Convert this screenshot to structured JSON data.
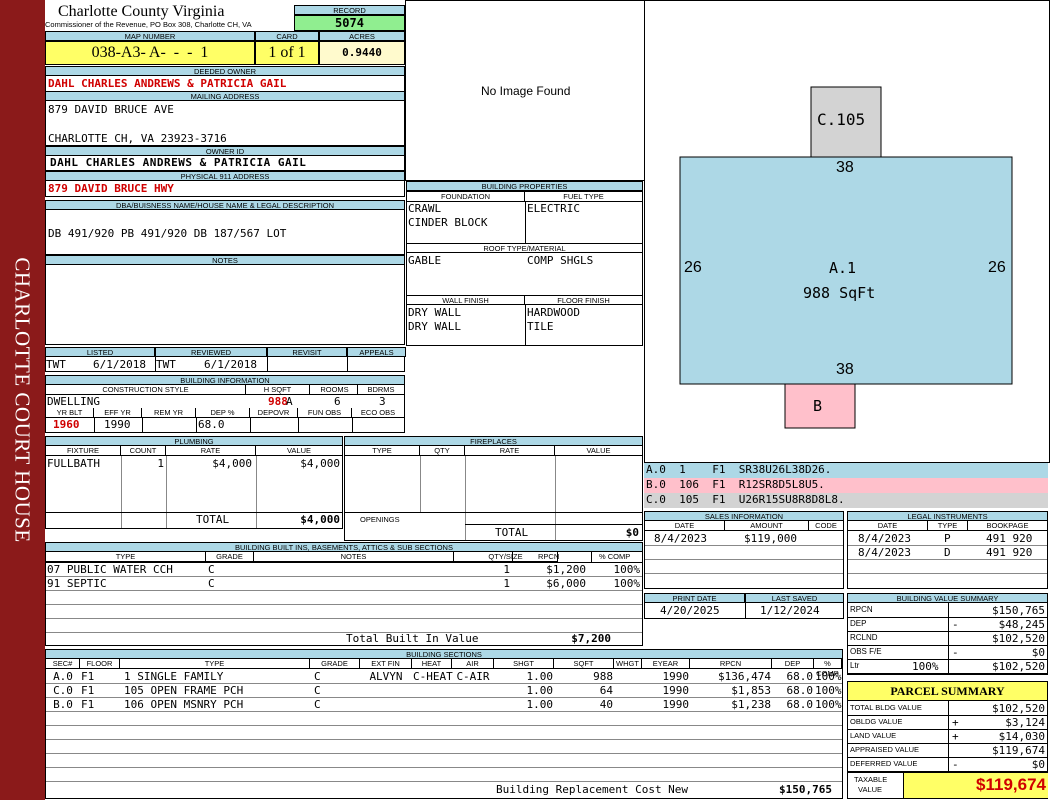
{
  "side_banner": "CHARLOTTE COURT HOUSE",
  "header": {
    "county": "Charlotte County Virginia",
    "office": "Commissioner of the Revenue, PO Box 308, Charlotte CH, VA",
    "record_label": "RECORD",
    "record": "5074",
    "map_label": "MAP NUMBER",
    "map": "038-A3- A-  -  -  1",
    "card_label": "CARD",
    "card": "1 of 1",
    "acres_label": "ACRES",
    "acres": "0.9440"
  },
  "owner": {
    "deeded_label": "DEEDED OWNER",
    "deeded": "DAHL CHARLES ANDREWS & PATRICIA GAIL",
    "mailing_label": "MAILING ADDRESS",
    "mail1": "879 DAVID BRUCE AVE",
    "mail2": "CHARLOTTE CH, VA 23923-3716",
    "ownerid_label": "OWNER ID",
    "ownerid": "DAHL CHARLES ANDREWS & PATRICIA GAIL",
    "phys_label": "PHYSICAL 911 ADDRESS",
    "phys": "879 DAVID BRUCE HWY"
  },
  "legal": {
    "label": "DBA/BUISNESS NAME/HOUSE NAME & LEGAL DESCRIPTION",
    "text": "DB 491/920 PB 491/920 DB 187/567 LOT"
  },
  "notes": {
    "label": "NOTES",
    "text": ""
  },
  "photo": {
    "text": "No Image Found"
  },
  "building_properties": {
    "label": "BUILDING PROPERTIES",
    "foundation_label": "FOUNDATION",
    "foundation1": "CRAWL",
    "foundation2": "CINDER BLOCK",
    "fuel_label": "FUEL TYPE",
    "fuel": "ELECTRIC",
    "roof_label": "ROOF TYPE/MATERIAL",
    "roof_type": "GABLE",
    "roof_mat": "COMP SHGLS",
    "wall_label": "WALL FINISH",
    "wall1": "DRY WALL",
    "wall2": "DRY WALL",
    "floor_label": "FLOOR FINISH",
    "floor1": "HARDWOOD",
    "floor2": "TILE"
  },
  "review": {
    "listed_label": "LISTED",
    "listed_by": "TWT",
    "listed_date": "6/1/2018",
    "reviewed_label": "REVIEWED",
    "reviewed_by": "TWT",
    "reviewed_date": "6/1/2018",
    "revisit_label": "REVISIT",
    "appeals_label": "APPEALS"
  },
  "building_info": {
    "label": "BUILDING INFORMATION",
    "style_label": "CONSTRUCTION STYLE",
    "style": "DWELLING",
    "hsqft_label": "H SQFT",
    "hsqft": "988",
    "cond_label": "COND",
    "cond": "A",
    "rooms_label": "ROOMS",
    "rooms": "6",
    "bdrms_label": "BDRMS",
    "bdrms": "3",
    "yrblt_label": "YR BLT",
    "yrblt": "1960",
    "effyr_label": "EFF YR",
    "effyr": "1990",
    "remyr_label": "REM YR",
    "remyr": "",
    "dep_label": "DEP %",
    "dep": "68.0",
    "depovr_label": "DEPOVR",
    "funobs_label": "FUN OBS",
    "ecoobs_label": "ECO OBS"
  },
  "plumbing": {
    "label": "PLUMBING",
    "headers": [
      "FIXTURE",
      "COUNT",
      "RATE",
      "VALUE"
    ],
    "rows": [
      [
        "FULLBATH",
        "1",
        "$4,000",
        "$4,000"
      ]
    ],
    "total_label": "TOTAL",
    "total": "$4,000"
  },
  "fireplaces": {
    "label": "FIREPLACES",
    "headers": [
      "TYPE",
      "QTY",
      "RATE",
      "VALUE"
    ],
    "openings_label": "OPENINGS",
    "total_label": "TOTAL",
    "total": "$0"
  },
  "sketch": {
    "c_label": "C.105",
    "a_label": "A.1",
    "a_sqft": "988 SqFt",
    "b_label": "B",
    "top": "38",
    "bottom": "38",
    "left": "26",
    "right": "26"
  },
  "sketch_codes": [
    {
      "text": "A.0  1    F1  SR38U26L38D26.",
      "color": "#add8e6"
    },
    {
      "text": "B.0  106  F1  R12SR8D5L8U5.",
      "color": "#ffc0cb"
    },
    {
      "text": "C.0  105  F1  U26R15SU8R8D8L8.",
      "color": "#d3d3d3"
    }
  ],
  "sales": {
    "label": "SALES INFORMATION",
    "headers": [
      "DATE",
      "AMOUNT",
      "CODE"
    ],
    "rows": [
      [
        "8/4/2023",
        "$119,000",
        ""
      ]
    ]
  },
  "legal_instruments": {
    "label": "LEGAL INSTRUMENTS",
    "headers": [
      "DATE",
      "TYPE",
      "BOOKPAGE"
    ],
    "rows": [
      [
        "8/4/2023",
        "P",
        "491 920"
      ],
      [
        "8/4/2023",
        "D",
        "491 920"
      ]
    ]
  },
  "print": {
    "print_label": "PRINT DATE",
    "print_date": "4/20/2025",
    "saved_label": "LAST SAVED",
    "saved_date": "1/12/2024"
  },
  "value_summary": {
    "label": "BUILDING VALUE SUMMARY",
    "rows": [
      {
        "k": "RPCN",
        "sign": "",
        "pct": "",
        "v": "$150,765"
      },
      {
        "k": "DEP",
        "sign": "-",
        "pct": "",
        "v": "$48,245"
      },
      {
        "k": "RCLND",
        "sign": "",
        "pct": "",
        "v": "$102,520"
      },
      {
        "k": "OBS F/E",
        "sign": "-",
        "pct": "",
        "v": "$0"
      },
      {
        "k": "Ltr",
        "sign": "",
        "pct": "100%",
        "v": "$102,520"
      }
    ]
  },
  "parcel_summary": {
    "label": "PARCEL SUMMARY",
    "rows": [
      {
        "k": "TOTAL BLDG VALUE",
        "sign": "",
        "v": "$102,520"
      },
      {
        "k": "OBLDG VALUE",
        "sign": "+",
        "v": "$3,124"
      },
      {
        "k": "LAND VALUE",
        "sign": "+",
        "v": "$14,030"
      },
      {
        "k": "APPRAISED VALUE",
        "sign": "",
        "v": "$119,674"
      },
      {
        "k": "DEFERRED VALUE",
        "sign": "-",
        "v": "$0"
      }
    ],
    "taxable_label1": "TAXABLE",
    "taxable_label2": "VALUE",
    "taxable": "$119,674"
  },
  "builtins": {
    "label": "BUILDING BUILT INS, BASEMENTS, ATTICS & SUB SECTIONS",
    "headers": [
      "TYPE",
      "GRADE",
      "NOTES",
      "QTY/SIZE",
      "RPCN",
      "% COMP"
    ],
    "rows": [
      [
        "07 PUBLIC WATER CCH",
        "C",
        "",
        "1",
        "$1,200",
        "100%"
      ],
      [
        "91 SEPTIC",
        "C",
        "",
        "1",
        "$6,000",
        "100%"
      ]
    ],
    "total_label": "Total Built In Value",
    "total": "$7,200"
  },
  "sections": {
    "label": "BUILDING SECTIONS",
    "headers": [
      "SEC#",
      "FLOOR",
      "TYPE",
      "GRADE",
      "EXT FIN",
      "HEAT",
      "AIR",
      "SHGT",
      "SQFT",
      "WHGT",
      "EYEAR",
      "RPCN",
      "DEP",
      "% COMP"
    ],
    "rows": [
      [
        "A.0",
        "F1",
        "1 SINGLE FAMILY",
        "C",
        "ALVYN",
        "C-HEAT",
        "C-AIR",
        "1.00",
        "988",
        "",
        "1990",
        "$136,474",
        "68.0",
        "100%"
      ],
      [
        "C.0",
        "F1",
        "105 OPEN FRAME PCH",
        "C",
        "",
        "",
        "",
        "1.00",
        "64",
        "",
        "1990",
        "$1,853",
        "68.0",
        "100%"
      ],
      [
        "B.0",
        "F1",
        "106 OPEN MSNRY PCH",
        "C",
        "",
        "",
        "",
        "1.00",
        "40",
        "",
        "1990",
        "$1,238",
        "68.0",
        "100%"
      ]
    ],
    "total_label": "Building Replacement Cost New",
    "total": "$150,765"
  }
}
